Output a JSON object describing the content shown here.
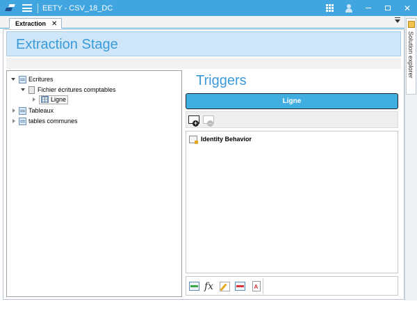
{
  "window": {
    "title": "EETY - CSV_18_DC"
  },
  "colors": {
    "accent": "#41a6e0",
    "header_bg": "#cfe6f8",
    "title_text": "#3a9ad9",
    "ligne_bar": "#41aee2"
  },
  "titlebar_icons": [
    "app-logo-icon",
    "menu-icon",
    "apps-grid-icon",
    "user-icon",
    "minimize-icon",
    "maximize-icon",
    "close-icon"
  ],
  "tabs": [
    {
      "label": "Extraction",
      "close": "✕"
    }
  ],
  "side_panel": {
    "label": "Solution explorer"
  },
  "stage": {
    "title": "Extraction Stage"
  },
  "tree": {
    "nodes": [
      {
        "label": "Ecritures",
        "state": "expanded",
        "children": [
          {
            "label": "Fichier écritures comptables",
            "state": "expanded",
            "children": [
              {
                "label": "Ligne",
                "state": "collapsed",
                "selected": true
              }
            ]
          }
        ]
      },
      {
        "label": "Tableaux",
        "state": "collapsed"
      },
      {
        "label": "tables communes",
        "state": "collapsed"
      }
    ]
  },
  "triggers": {
    "title": "Triggers",
    "selected": "Ligne",
    "items": [
      {
        "label": "Identity Behavior"
      }
    ]
  },
  "bottom_toolbar_icons": [
    "add-green-icon",
    "fx-icon",
    "edit-icon",
    "remove-red-icon",
    "document-icon"
  ]
}
